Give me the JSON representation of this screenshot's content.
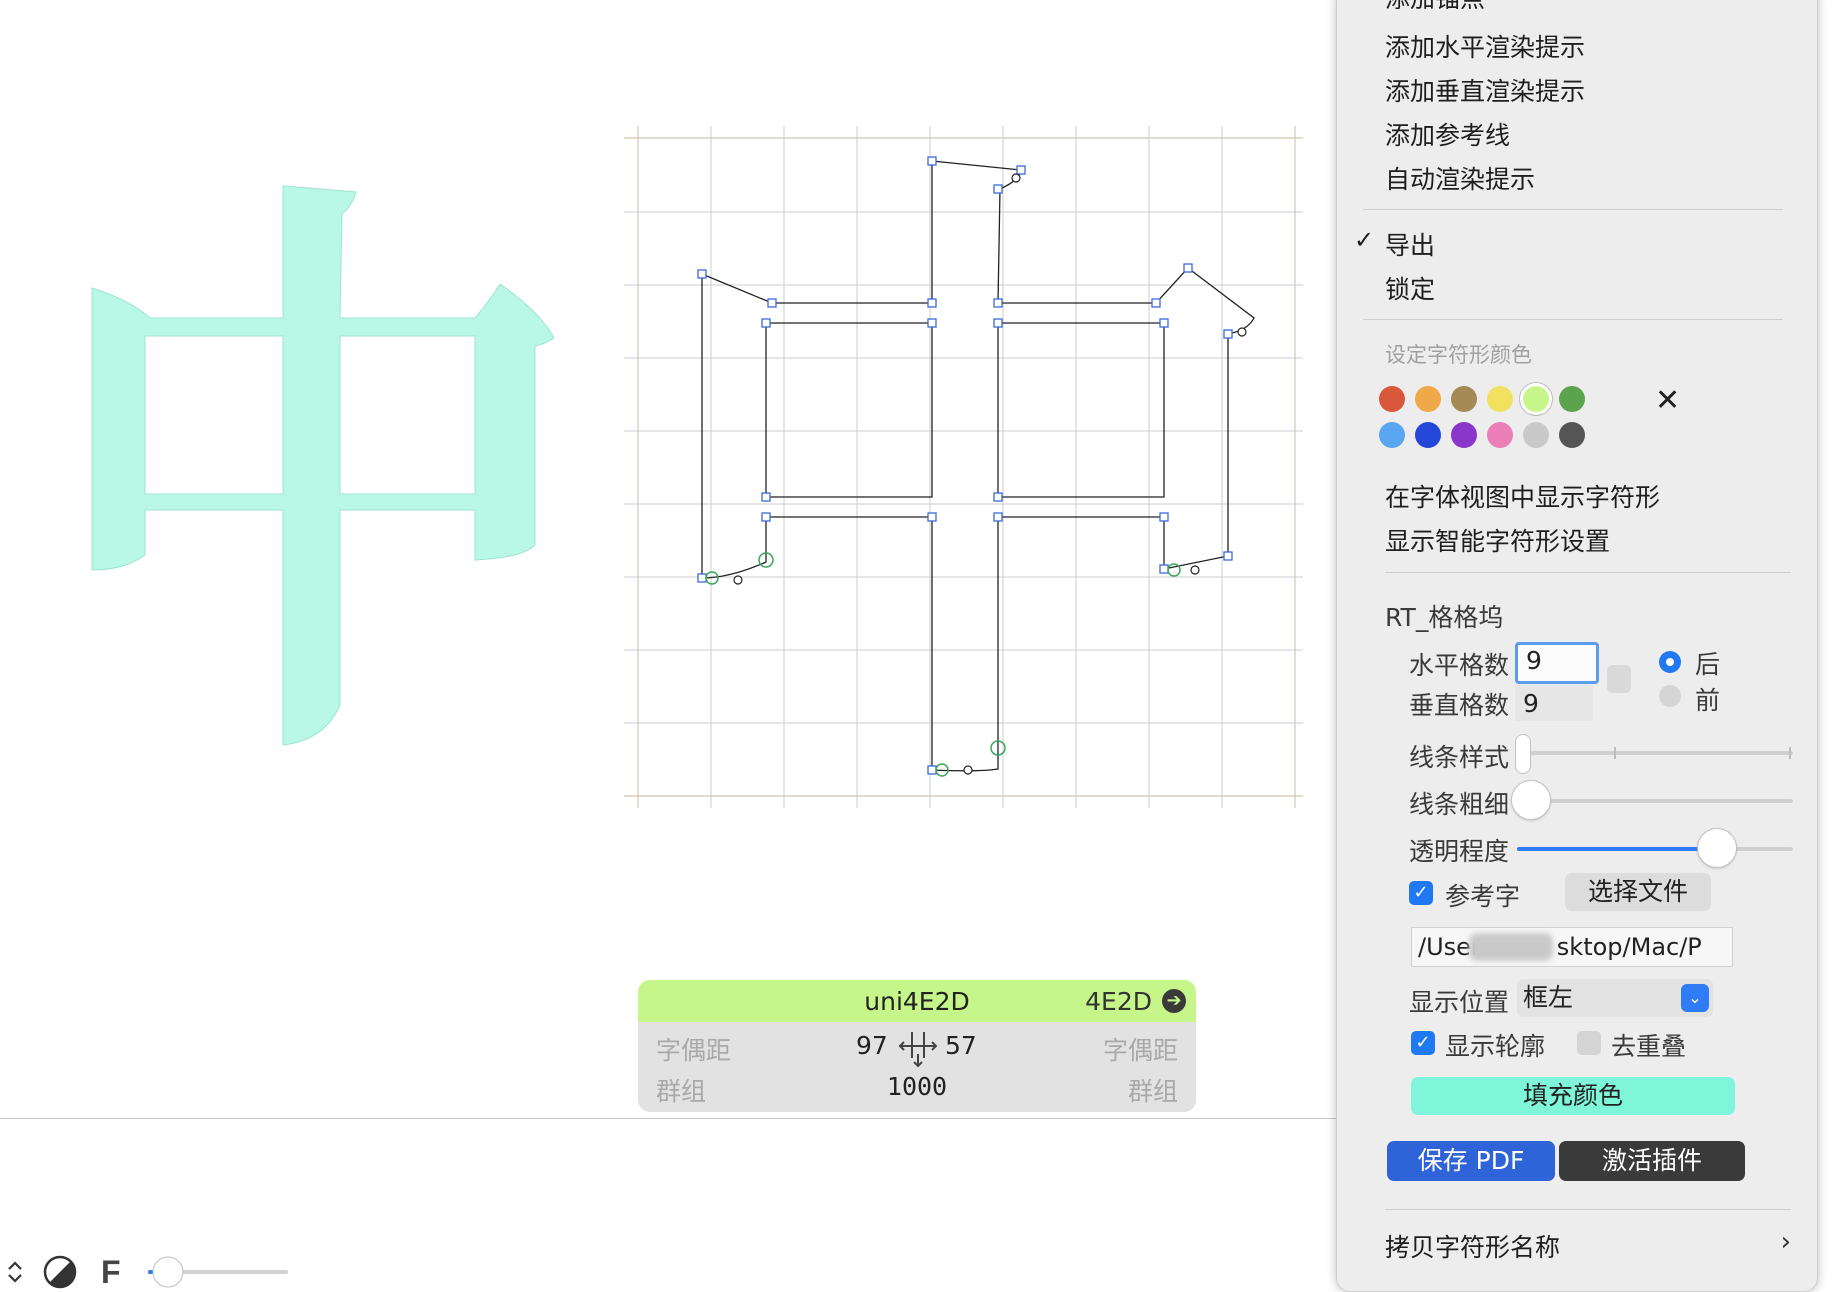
{
  "glyph": {
    "preview_char": "中",
    "fill_color": "#b9f7e6",
    "name": "uni4E2D",
    "unicode": "4E2D",
    "lsb_label": "字偶距",
    "rsb_label": "字偶距",
    "left_group_label": "群组",
    "right_group_label": "群组",
    "lsb": "97",
    "rsb": "57",
    "width": "1000",
    "header_color": "#c6f68a"
  },
  "bottom_toolbar": {
    "font_label": "F"
  },
  "menu": {
    "top_partial": "添加锚点",
    "items_top": [
      "添加水平渲染提示",
      "添加垂直渲染提示",
      "添加参考线",
      "自动渲染提示"
    ],
    "export_label": "导出",
    "export_checked": true,
    "lock_label": "锁定",
    "color_heading": "设定字符形颜色",
    "colors_row1": [
      "#d9573b",
      "#f0a84a",
      "#a68a55",
      "#f2e05f",
      "#c6f68a",
      "#5ba44d"
    ],
    "colors_row2": [
      "#5aa6f0",
      "#2547d8",
      "#8a35c9",
      "#ec7fb7",
      "#c8c8c8",
      "#555555"
    ],
    "selected_color_index": 4,
    "show_in_font_view": "在字体视图中显示字符形",
    "show_smart_settings": "显示智能字符形设置",
    "copy_name": "拷贝字符形名称"
  },
  "plugin": {
    "title": "RT_格格坞",
    "h_cells_label": "水平格数",
    "h_cells": "9",
    "v_cells_label": "垂直格数",
    "v_cells": "9",
    "radio_back": "后",
    "radio_front": "前",
    "radio_selected": "后",
    "line_style_label": "线条样式",
    "line_width_label": "线条粗细",
    "opacity_label": "透明程度",
    "opacity_value": 0.72,
    "ref_char_label": "参考字",
    "ref_char_checked": true,
    "choose_file": "选择文件",
    "file_path": "/User",
    "file_path_tail": "sktop/Mac/P",
    "position_label": "显示位置",
    "position_value": "框左",
    "show_outline_label": "显示轮廓",
    "show_outline_checked": true,
    "remove_overlap_label": "去重叠",
    "remove_overlap_checked": false,
    "fill_color_button": "填充颜色",
    "fill_color_button_bg": "#7ff5da",
    "save_pdf": "保存 PDF",
    "save_pdf_bg": "#2f63d8",
    "activate_plugin": "激活插件",
    "activate_bg": "#3a3a3a"
  }
}
